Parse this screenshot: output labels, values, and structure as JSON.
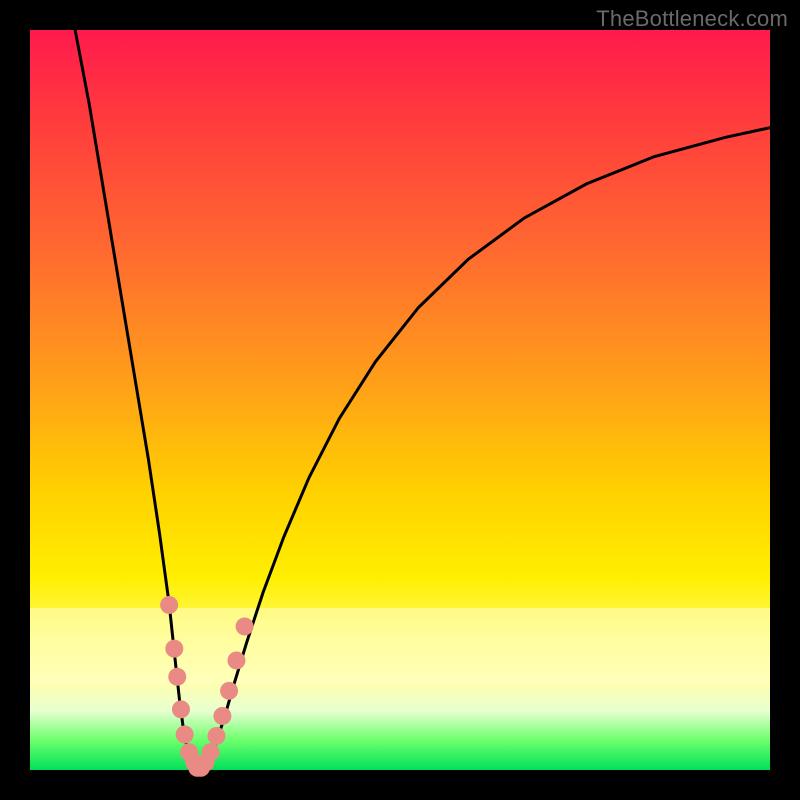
{
  "watermark": "TheBottleneck.com",
  "colors": {
    "frame": "#000000",
    "gradient_top": "#ff1a4d",
    "gradient_mid": "#ffd000",
    "gradient_bottom": "#00e05a",
    "curve": "#000000",
    "dots": "#e98b84"
  },
  "chart_data": {
    "type": "line",
    "title": "",
    "xlabel": "",
    "ylabel": "",
    "xlim": [
      0,
      100
    ],
    "ylim": [
      0,
      100
    ],
    "curve": {
      "name": "bottleneck-curve",
      "points": [
        {
          "x": 6.1,
          "y": 100.0
        },
        {
          "x": 8.0,
          "y": 90.0
        },
        {
          "x": 10.0,
          "y": 78.0
        },
        {
          "x": 12.0,
          "y": 66.0
        },
        {
          "x": 14.0,
          "y": 54.0
        },
        {
          "x": 16.0,
          "y": 42.0
        },
        {
          "x": 17.5,
          "y": 32.0
        },
        {
          "x": 18.8,
          "y": 22.5
        },
        {
          "x": 19.6,
          "y": 15.0
        },
        {
          "x": 20.2,
          "y": 9.5
        },
        {
          "x": 20.8,
          "y": 5.0
        },
        {
          "x": 21.4,
          "y": 2.3
        },
        {
          "x": 22.1,
          "y": 0.8
        },
        {
          "x": 22.8,
          "y": 0.2
        },
        {
          "x": 23.5,
          "y": 0.5
        },
        {
          "x": 24.3,
          "y": 1.7
        },
        {
          "x": 25.2,
          "y": 3.8
        },
        {
          "x": 26.3,
          "y": 7.2
        },
        {
          "x": 27.6,
          "y": 11.7
        },
        {
          "x": 29.3,
          "y": 17.3
        },
        {
          "x": 31.5,
          "y": 24.0
        },
        {
          "x": 34.3,
          "y": 31.5
        },
        {
          "x": 37.7,
          "y": 39.5
        },
        {
          "x": 41.8,
          "y": 47.5
        },
        {
          "x": 46.7,
          "y": 55.2
        },
        {
          "x": 52.5,
          "y": 62.5
        },
        {
          "x": 59.2,
          "y": 69.0
        },
        {
          "x": 66.8,
          "y": 74.6
        },
        {
          "x": 75.2,
          "y": 79.2
        },
        {
          "x": 84.4,
          "y": 82.9
        },
        {
          "x": 94.0,
          "y": 85.5
        },
        {
          "x": 100.0,
          "y": 86.8
        }
      ]
    },
    "series": [
      {
        "name": "left-branch-dots",
        "points": [
          {
            "x": 18.8,
            "y": 22.3
          },
          {
            "x": 19.5,
            "y": 16.4
          },
          {
            "x": 19.9,
            "y": 12.6
          },
          {
            "x": 20.4,
            "y": 8.2
          },
          {
            "x": 20.9,
            "y": 4.8
          },
          {
            "x": 21.5,
            "y": 2.4
          },
          {
            "x": 22.2,
            "y": 1.0
          }
        ]
      },
      {
        "name": "right-branch-dots",
        "points": [
          {
            "x": 23.7,
            "y": 1.0
          },
          {
            "x": 24.4,
            "y": 2.4
          },
          {
            "x": 25.2,
            "y": 4.6
          },
          {
            "x": 26.0,
            "y": 7.3
          },
          {
            "x": 26.9,
            "y": 10.7
          },
          {
            "x": 27.9,
            "y": 14.8
          },
          {
            "x": 29.0,
            "y": 19.4
          }
        ]
      },
      {
        "name": "trough-dots",
        "points": [
          {
            "x": 22.6,
            "y": 0.3
          },
          {
            "x": 23.1,
            "y": 0.3
          }
        ]
      }
    ]
  }
}
